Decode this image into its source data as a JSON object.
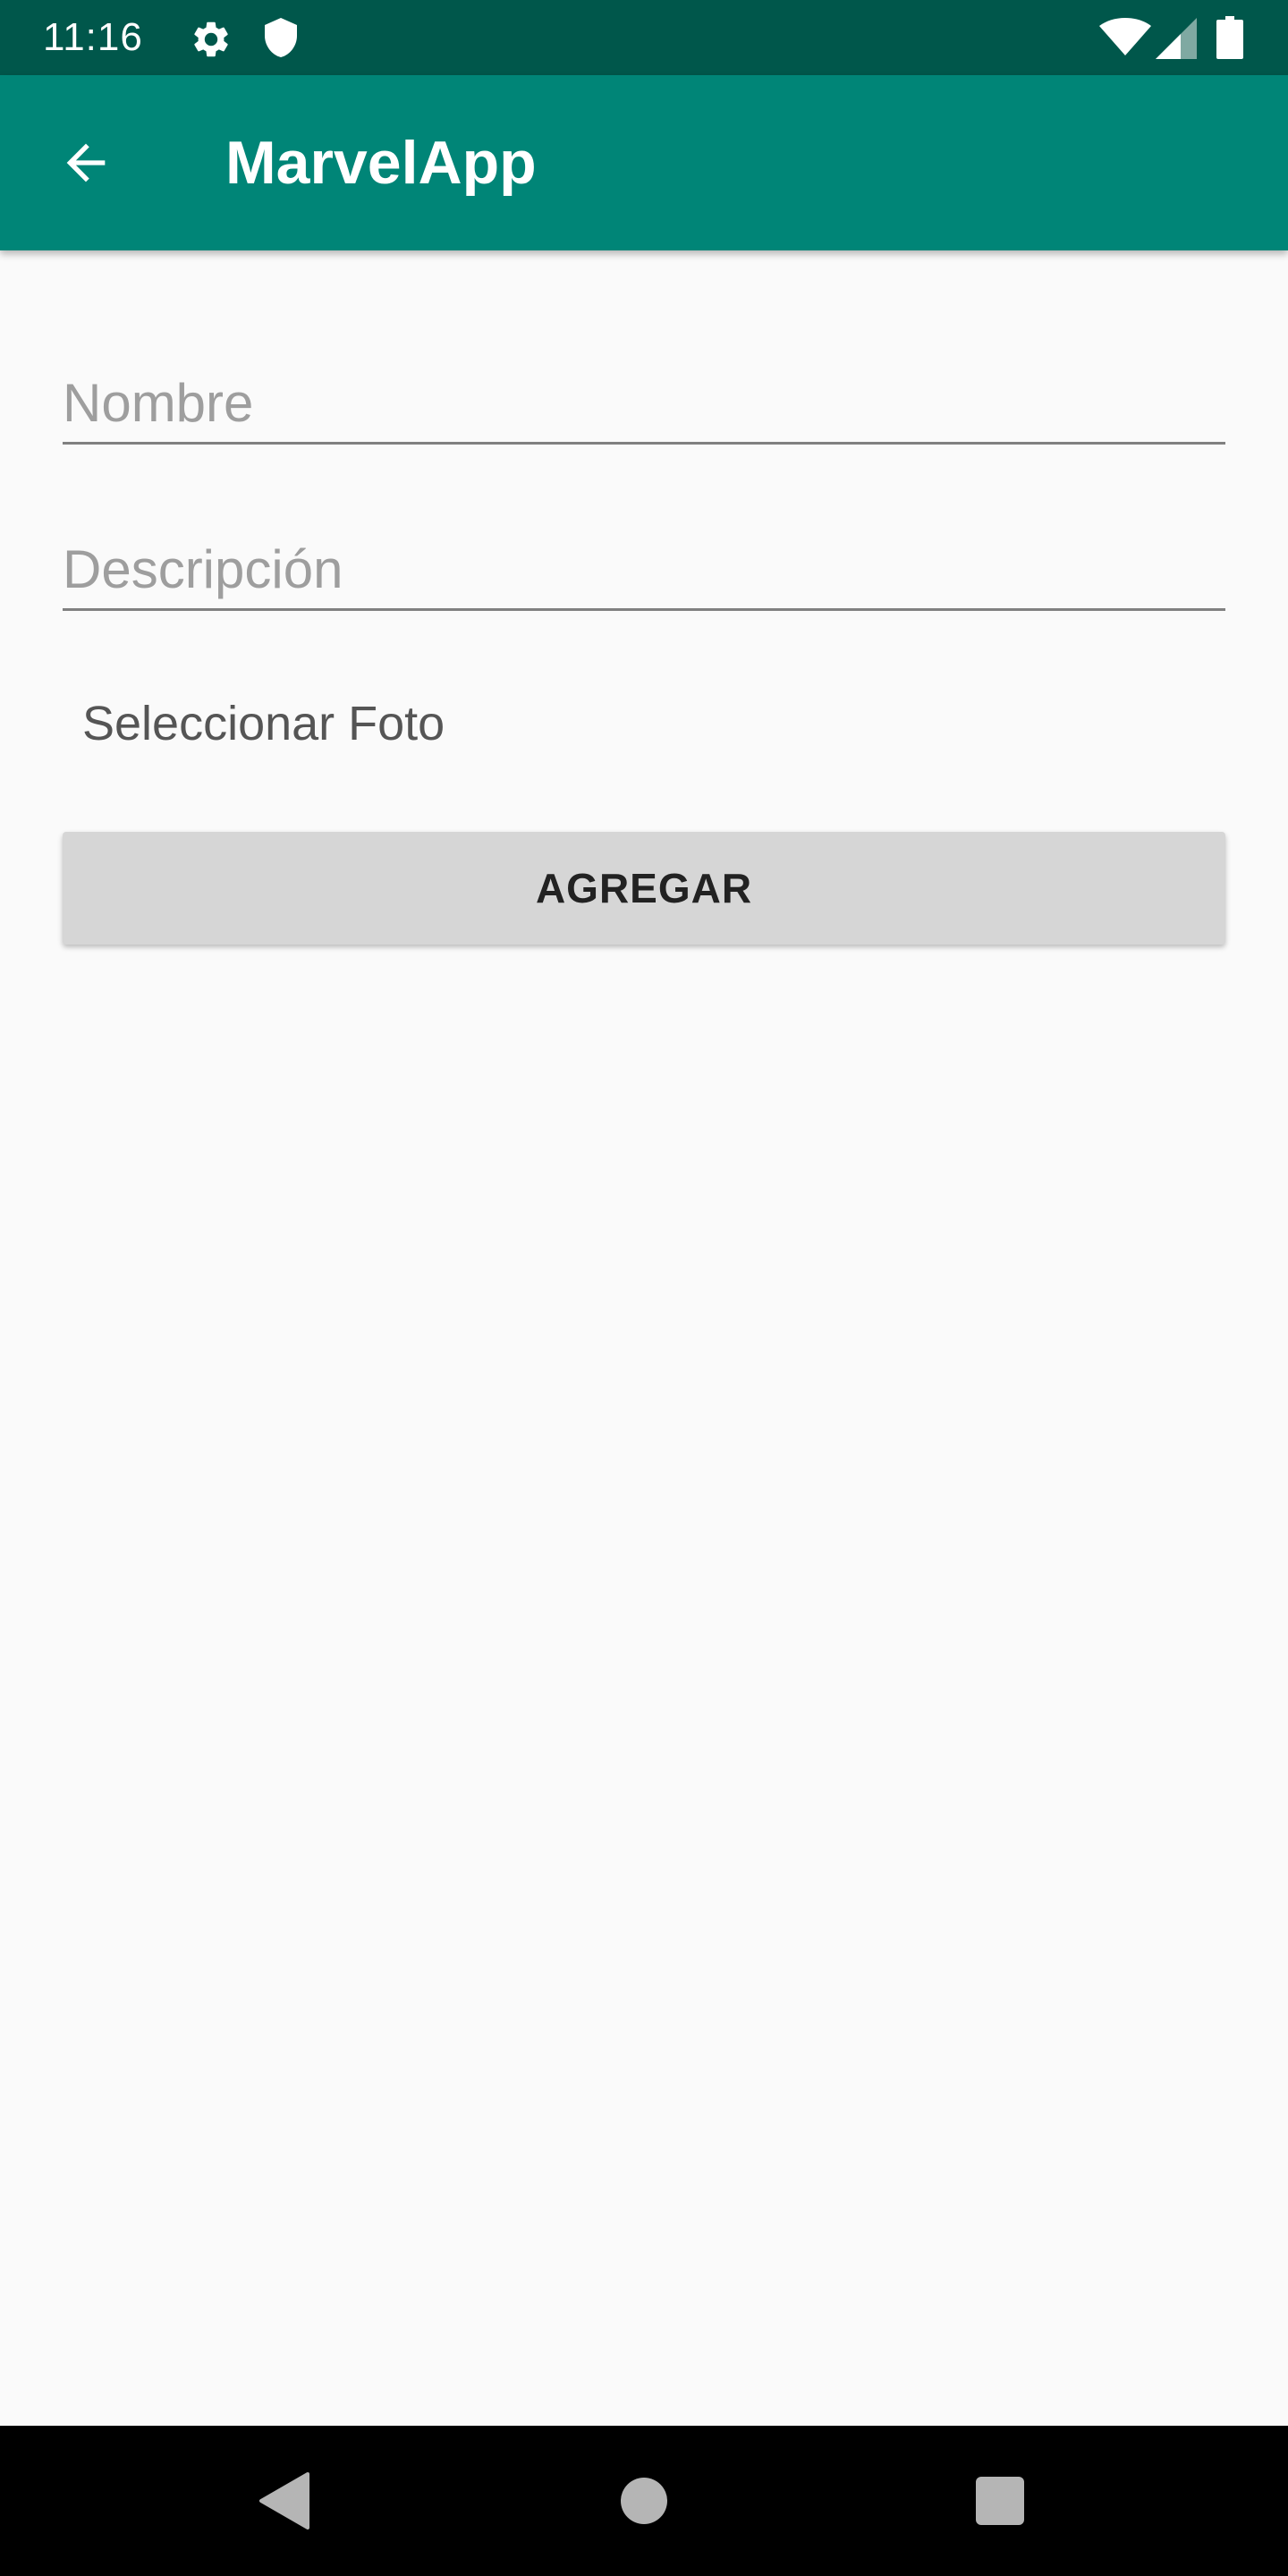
{
  "status_bar": {
    "time": "11:16",
    "icons": [
      "gear-icon",
      "shield-icon",
      "wifi-icon",
      "cell-signal-icon",
      "battery-icon"
    ],
    "background": "#00574b"
  },
  "app_bar": {
    "title": "MarvelApp",
    "back_icon": "arrow-back-icon",
    "background": "#008577"
  },
  "form": {
    "name_placeholder": "Nombre",
    "name_value": "",
    "description_placeholder": "Descripción",
    "description_value": "",
    "select_photo_label": "Seleccionar Foto",
    "add_button_label": "AGREGAR"
  },
  "nav_bar": {
    "icons": [
      "back-triangle-icon",
      "home-circle-icon",
      "recents-square-icon"
    ]
  }
}
